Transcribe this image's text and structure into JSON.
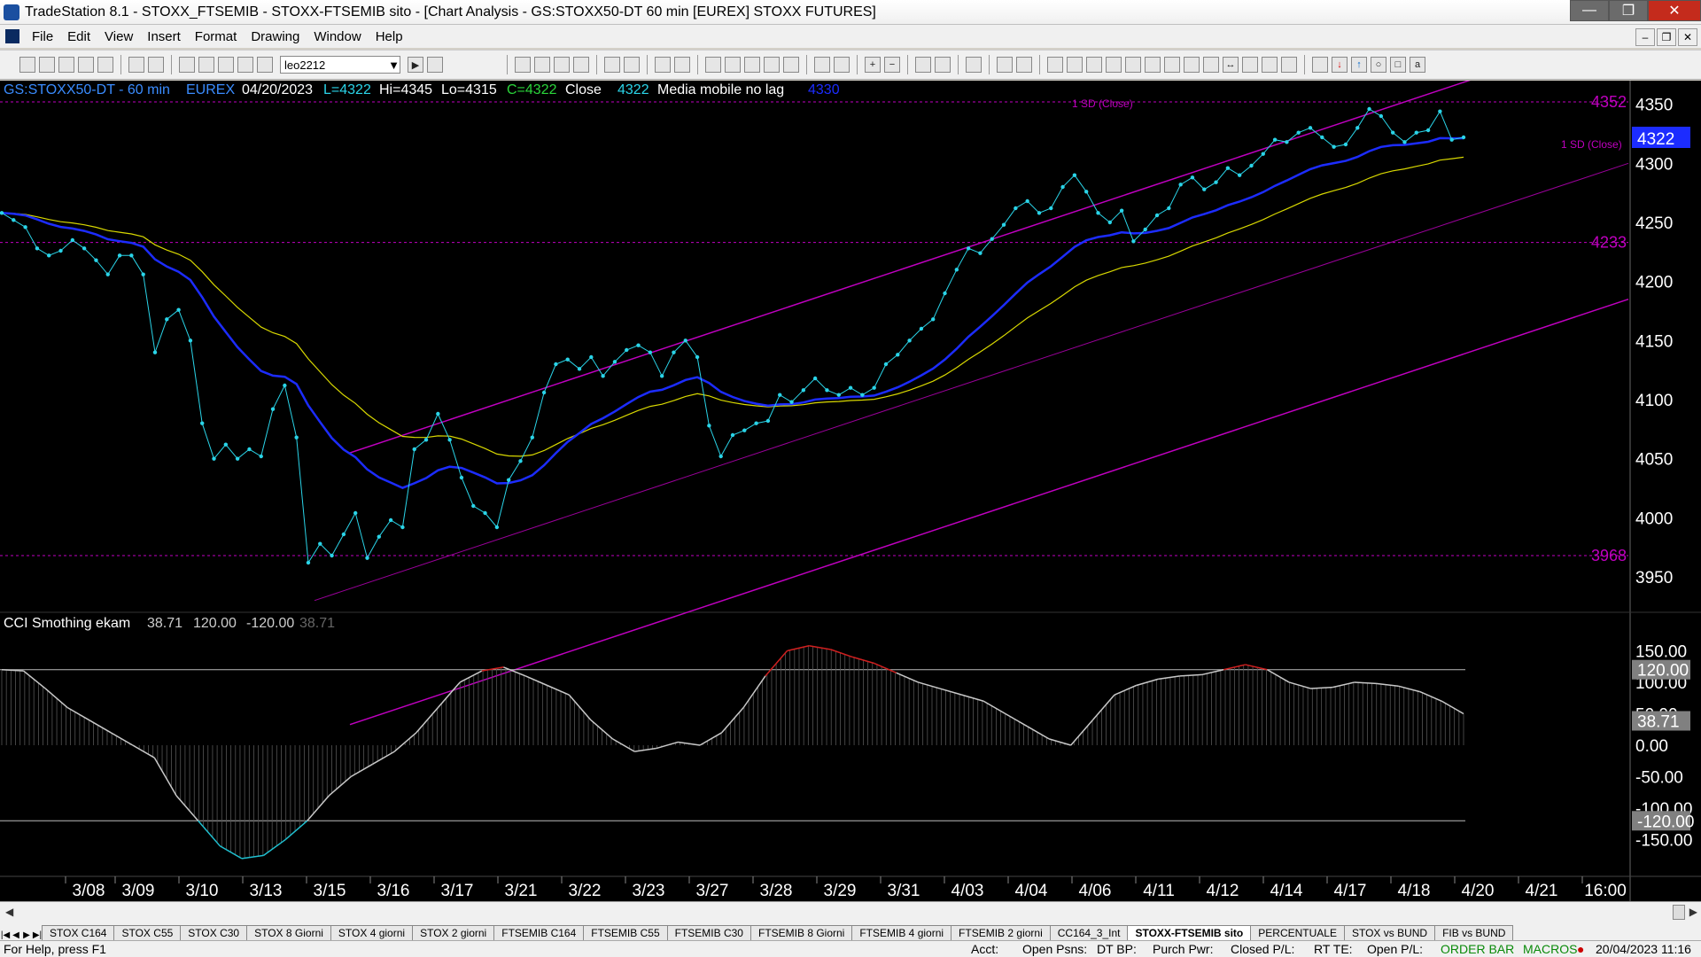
{
  "window": {
    "title": "TradeStation 8.1 - STOXX_FTSEMIB - STOXX-FTSEMIB sito - [Chart Analysis - GS:STOXX50-DT  60 min  [EUREX] STOXX FUTURES]"
  },
  "menu": [
    "File",
    "Edit",
    "View",
    "Insert",
    "Format",
    "Drawing",
    "Window",
    "Help"
  ],
  "toolbar": {
    "workspace_combo": "leo2212"
  },
  "chart_header": {
    "symbol": "GS:STOXX50-DT - 60 min",
    "exchange": "EUREX",
    "date": "04/20/2023",
    "last": "L=4322",
    "high": "Hi=4345",
    "low": "Lo=4315",
    "close": "C=4322",
    "close_label": "Close",
    "close_value": "4322",
    "indicator_name": "Media mobile no lag",
    "indicator_value": "4330"
  },
  "price_axis": {
    "ticks": [
      "4350",
      "4300",
      "4250",
      "4200",
      "4150",
      "4100",
      "4050",
      "4000",
      "3950"
    ],
    "current_price": "4322",
    "level_high": "4352",
    "level_mid": "4233",
    "level_low": "3968",
    "sd_label": "1 SD (Close)"
  },
  "cci_header": {
    "name": "CCI Smothing ekam",
    "v1": "38.71",
    "v2": "120.00",
    "v3": "-120.00",
    "v4": "38.71"
  },
  "cci_axis": {
    "ticks": [
      "150.00",
      "100.00",
      "50.00",
      "0.00",
      "-50.00",
      "-100.00",
      "-150.00"
    ],
    "upper_level": "120.00",
    "current": "38.71",
    "lower_level": "-120.00"
  },
  "time_axis": [
    "3/08",
    "3/09",
    "3/10",
    "3/13",
    "3/15",
    "3/16",
    "3/17",
    "3/21",
    "3/22",
    "3/23",
    "3/27",
    "3/28",
    "3/29",
    "3/31",
    "4/03",
    "4/04",
    "4/06",
    "4/11",
    "4/12",
    "4/14",
    "4/17",
    "4/18",
    "4/20",
    "4/21",
    "16:00"
  ],
  "colors": {
    "price_series": "#2ad4e8",
    "fast_ma": "#1c2cff",
    "slow_ma": "#d8d800",
    "channel": "#c000c0",
    "cci": "#c8c8c8",
    "cci_overbought": "#d02020",
    "cci_oversold": "#20c0d0"
  },
  "sheet_tabs": [
    "STOX C164",
    "STOX C55",
    "STOX  C30",
    "STOX  8 Giorni",
    "STOX 4 giorni",
    "STOX  2 giorni",
    "FTSEMIB C164",
    "FTSEMIB C55",
    "FTSEMIB C30",
    "FTSEMIB  8 Giorni",
    "FTSEMIB  4 giorni",
    "FTSEMIB  2 giorni",
    "CC164_3_Int",
    "STOXX-FTSEMIB sito",
    "PERCENTUALE",
    "STOX vs BUND",
    "FIB vs BUND"
  ],
  "active_tab": "STOXX-FTSEMIB sito",
  "status": {
    "help": "For Help, press F1",
    "acct": "Acct:",
    "open_psns": "Open Psns:",
    "dt_bp": "DT BP:",
    "purch_pwr": "Purch Pwr:",
    "closed_pl": "Closed P/L:",
    "rt_te": "RT TE:",
    "open_pl": "Open P/L:",
    "order_bar": "ORDER BAR",
    "macros": "MACROS",
    "datetime": "20/04/2023 11:16"
  },
  "chart_data": {
    "type": "line",
    "price_closes": [
      4258,
      4252,
      4246,
      4228,
      4222,
      4226,
      4235,
      4228,
      4218,
      4206,
      4222,
      4222,
      4206,
      4140,
      4168,
      4176,
      4150,
      4080,
      4050,
      4062,
      4050,
      4058,
      4052,
      4092,
      4112,
      4068,
      3962,
      3978,
      3968,
      3986,
      4004,
      3966,
      3984,
      3998,
      3992,
      4058,
      4066,
      4088,
      4066,
      4034,
      4010,
      4004,
      3992,
      4032,
      4048,
      4068,
      4106,
      4130,
      4134,
      4126,
      4136,
      4120,
      4132,
      4142,
      4146,
      4140,
      4120,
      4140,
      4150,
      4136,
      4078,
      4052,
      4070,
      4074,
      4080,
      4082,
      4104,
      4098,
      4108,
      4118,
      4108,
      4104,
      4110,
      4104,
      4110,
      4130,
      4138,
      4150,
      4160,
      4168,
      4190,
      4210,
      4228,
      4224,
      4236,
      4248,
      4262,
      4268,
      4258,
      4262,
      4280,
      4290,
      4276,
      4258,
      4250,
      4260,
      4234,
      4244,
      4256,
      4262,
      4282,
      4288,
      4278,
      4284,
      4296,
      4290,
      4298,
      4308,
      4320,
      4318,
      4326,
      4330,
      4322,
      4314,
      4316,
      4330,
      4346,
      4340,
      4326,
      4318,
      4326,
      4328,
      4344,
      4320,
      4322
    ],
    "cci_values": [
      120,
      118,
      90,
      60,
      40,
      20,
      0,
      -20,
      -80,
      -120,
      -160,
      -180,
      -175,
      -150,
      -120,
      -80,
      -50,
      -30,
      -10,
      20,
      60,
      100,
      118,
      124,
      110,
      95,
      80,
      40,
      10,
      -10,
      -5,
      5,
      0,
      20,
      60,
      110,
      150,
      158,
      152,
      140,
      130,
      115,
      100,
      90,
      80,
      70,
      50,
      30,
      10,
      0,
      40,
      80,
      95,
      105,
      110,
      112,
      120,
      128,
      120,
      100,
      90,
      92,
      100,
      98,
      94,
      85,
      70,
      50
    ],
    "cci_levels": [
      120,
      -120
    ],
    "x_tick_labels": [
      "3/08",
      "3/09",
      "3/10",
      "3/13",
      "3/15",
      "3/16",
      "3/17",
      "3/21",
      "3/22",
      "3/23",
      "3/27",
      "3/28",
      "3/29",
      "3/31",
      "4/03",
      "4/04",
      "4/06",
      "4/11",
      "4/12",
      "4/14",
      "4/17",
      "4/18",
      "4/20",
      "4/21",
      "16:00"
    ],
    "price_ylim": [
      3920,
      4370
    ],
    "cci_ylim": [
      -190,
      190
    ],
    "channel": {
      "start_price": 3930,
      "end_price": 4300,
      "width": 230
    }
  }
}
